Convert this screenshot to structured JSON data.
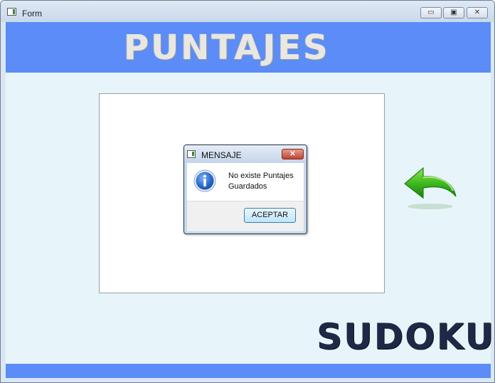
{
  "window": {
    "title": "Form",
    "controls": {
      "minimize": "▭",
      "maximize": "▣",
      "close": "✕"
    }
  },
  "header": {
    "title": "PUNTAJES"
  },
  "logo": {
    "text": "SUDOKU"
  },
  "dialog": {
    "title": "MENSAJE",
    "close_label": "✕",
    "message": "No existe Puntajes Guardados",
    "ok_label": "ACEPTAR",
    "icon": "info-icon"
  },
  "icons": {
    "back": "back-arrow-icon"
  },
  "colors": {
    "banner": "#5b8cf7",
    "content_bg": "#e7f5fb",
    "logo": "#1f2845",
    "arrow": "#3ab51c"
  }
}
